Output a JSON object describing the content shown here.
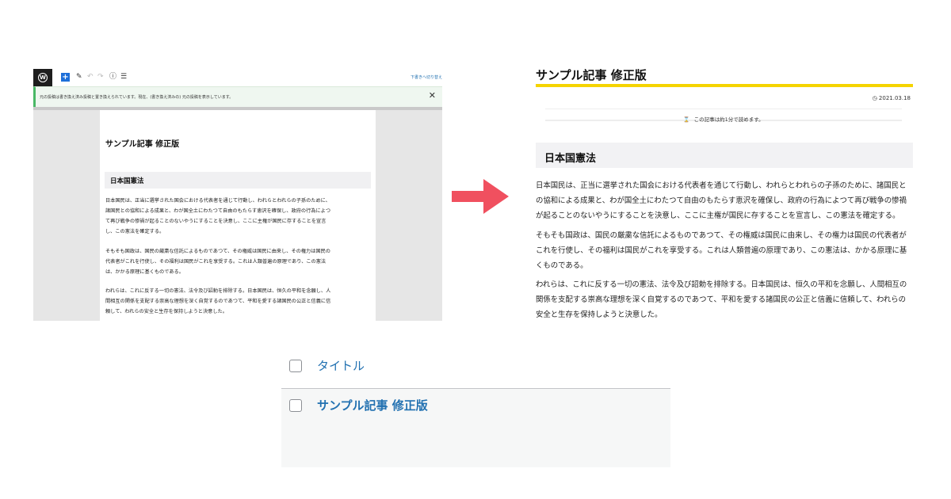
{
  "editor": {
    "toolbar": {
      "wp_logo": "wordpress-logo",
      "icons": [
        "plus-icon",
        "pencil-icon",
        "undo-icon",
        "redo-icon",
        "info-icon",
        "list-view-icon"
      ],
      "switch_to_draft": "下書きへ切り替え"
    },
    "notice": {
      "text": "元の投稿は書き換え済み投稿と置き換えられています。現在、(書き換え済みの) 元の投稿を表示しています。",
      "close_icon": "close-icon"
    },
    "title": "サンプル記事 修正版",
    "heading": "日本国憲法",
    "paragraphs": [
      [
        "日本国民は、正当に選挙された国会における代表者を通じて行動し、われらとわれらの子孫のために、",
        "諸国民との協和による成果と、わが国全土にわたつて自由のもたらす恵沢を確保し、政府の行為によつ",
        "て再び戦争の惨禍が起ることのないやうにすることを決意し、ここに主権が国民に存することを宣言",
        "し、この憲法を確定する。"
      ],
      [
        "そもそも国政は、国民の厳粛な信託によるものであつて、その権威は国民に由来し、その権力は国民の",
        "代表者がこれを行使し、その福利は国民がこれを享受する。これは人類普遍の原理であり、この憲法",
        "は、かかる原理に基くものである。"
      ],
      [
        "われらは、これに反する一切の憲法、法令及び詔勅を排除する。日本国民は、恒久の平和を念願し、人",
        "間相互の関係を支配する崇高な理想を深く自覚するのであつて、平和を愛する諸国民の公正と信義に信",
        "頼して、われらの安全と生存を保持しようと決意した。"
      ]
    ]
  },
  "arrow": {
    "color": "#f0505f",
    "icon": "right-arrow-icon"
  },
  "preview": {
    "title": "サンプル記事 修正版",
    "date": "2021.03.18",
    "clock_icon": "clock-icon",
    "reading_time": "この記事は約1分で読めます。",
    "hourglass_icon": "hourglass-icon",
    "heading": "日本国憲法",
    "accent_color": "#f5d400",
    "paragraphs": [
      [
        "日本国民は、正当に選挙された国会における代表者を通じて行動し、われらとわれらの子孫のために、諸国民と",
        "の協和による成果と、わが国全土にわたつて自由のもたらす恵沢を確保し、政府の行為によつて再び戦争の惨禍",
        "が起ることのないやうにすることを決意し、ここに主権が国民に存することを宣言し、この憲法を確定する。"
      ],
      [
        "そもそも国政は、国民の厳粛な信託によるものであつて、その権威は国民に由来し、その権力は国民の代表者が",
        "これを行使し、その福利は国民がこれを享受する。これは人類普遍の原理であり、この憲法は、かかる原理に基",
        "くものである。"
      ],
      [
        "われらは、これに反する一切の憲法、法令及び詔勅を排除する。日本国民は、恒久の平和を念願し、人間相互の",
        "関係を支配する崇高な理想を深く自覚するのであつて、平和を愛する諸国民の公正と信義に信頼して、われらの",
        "安全と生存を保持しようと決意した。"
      ]
    ]
  },
  "post_list": {
    "header_label": "タイトル",
    "rows": [
      {
        "title": "サンプル記事 修正版"
      }
    ],
    "link_color": "#2271b1"
  }
}
